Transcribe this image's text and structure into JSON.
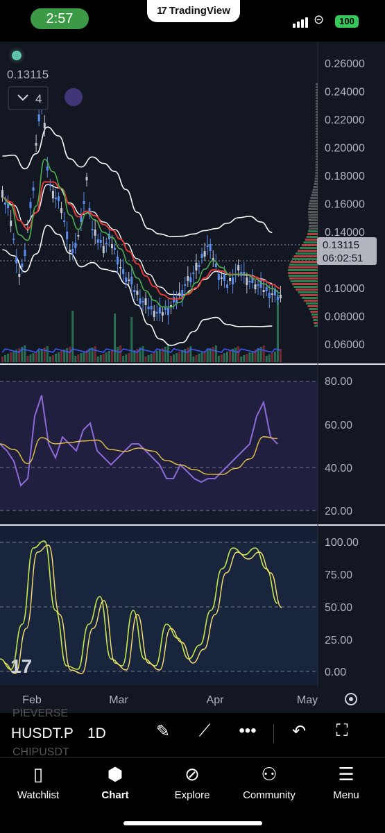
{
  "status_bar": {
    "time": "2:57",
    "app_name": "TradingView",
    "battery": "100",
    "accent": "#3c9a46"
  },
  "chart": {
    "last_price": "0.13115",
    "collapse_count": "4",
    "price_label": "0.13115",
    "countdown": "06:02:51",
    "price_axis": [
      "0.26000",
      "0.24000",
      "0.22000",
      "0.20000",
      "0.18000",
      "0.16000",
      "0.14000",
      "0.12000",
      "0.10000",
      "0.08000",
      "0.06000"
    ],
    "rsi_axis": [
      "80.00",
      "60.00",
      "40.00",
      "20.00"
    ],
    "stoch_axis": [
      "100.00",
      "75.00",
      "50.00",
      "25.00",
      "0.00"
    ],
    "time_axis": [
      "Feb",
      "Mar",
      "Apr",
      "May"
    ],
    "colors": {
      "up": "#5b8def",
      "down": "#e04848",
      "ema_red": "#e53935",
      "ema_green": "#4caf50",
      "rsi": "#8e6ad8",
      "rsi_ma": "#e8c547",
      "stoch_k": "#c6e84a",
      "stoch_d": "#ffe36e"
    }
  },
  "toolbar": {
    "symbol": "HUSDT.P",
    "interval": "1D",
    "faded_top": "PIEVERSE",
    "faded_bottom": "CHIPUSDT"
  },
  "nav": {
    "watchlist": "Watchlist",
    "chart": "Chart",
    "explore": "Explore",
    "community": "Community",
    "menu": "Menu"
  },
  "chart_data": {
    "type": "line",
    "x": [
      "Feb",
      "Mar",
      "Apr",
      "May"
    ],
    "series": [],
    "ylim": [
      0.05,
      0.27
    ]
  }
}
